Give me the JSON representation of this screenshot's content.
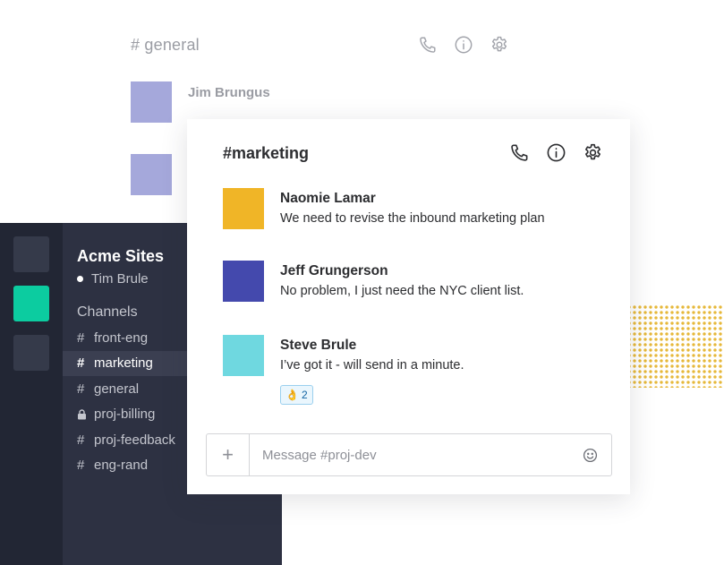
{
  "background_channel": {
    "title": "# general",
    "message_author": "Jim Brungus",
    "icons": [
      "phone-icon",
      "info-icon",
      "gear-icon"
    ],
    "avatar_color": "#a5a8db"
  },
  "rail": {
    "active_color": "#0ccca0"
  },
  "sidebar": {
    "workspace_name": "Acme Sites",
    "user_name": "Tim Brule",
    "channels_heading": "Channels",
    "channels": [
      {
        "prefix": "#",
        "name": "front-eng",
        "locked": false,
        "active": false
      },
      {
        "prefix": "#",
        "name": "marketing",
        "locked": false,
        "active": true
      },
      {
        "prefix": "#",
        "name": "general",
        "locked": false,
        "active": false
      },
      {
        "prefix": "lock",
        "name": "proj-billing",
        "locked": true,
        "active": false
      },
      {
        "prefix": "#",
        "name": "proj-feedback",
        "locked": false,
        "active": false
      },
      {
        "prefix": "#",
        "name": "eng-rand",
        "locked": false,
        "active": false
      }
    ]
  },
  "channel": {
    "title": "#marketing",
    "icons": [
      "phone-icon",
      "info-icon",
      "gear-icon"
    ],
    "messages": [
      {
        "author": "Naomie Lamar",
        "text": "We need to revise the inbound marketing plan",
        "avatar_color": "#f0b527"
      },
      {
        "author": "Jeff Grungerson",
        "text": "No problem, I just need the NYC client list.",
        "avatar_color": "#4449ad"
      },
      {
        "author": "Steve Brule",
        "text": "I’ve got it - will send in a minute.",
        "avatar_color": "#6fd8e0",
        "reaction": {
          "emoji": "👌",
          "count": "2"
        }
      }
    ]
  },
  "composer": {
    "add_label": "+",
    "placeholder": "Message #proj-dev",
    "emoji_icon": "smiley-icon"
  },
  "colors": {
    "sidebar_bg": "#2d3142",
    "rail_bg": "#222634",
    "accent": "#0ccca0",
    "dots": "#e6b83a"
  }
}
